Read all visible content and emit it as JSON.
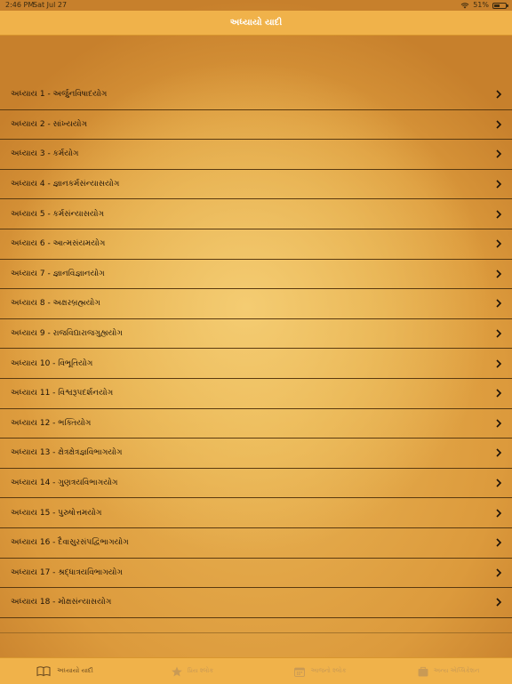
{
  "status_bar": {
    "time": "2:46 PM",
    "date": "Sat Jul 27",
    "battery_text": "51%",
    "battery_level": 0.51
  },
  "nav": {
    "title": "અધ્યાયો યાદી"
  },
  "chapters": [
    "અધ્યાય 1 - અર્જુનવિષાદયોગ",
    "અધ્યાય 2 - સાંખ્યયોગ",
    "અધ્યાય 3 - કર્મયોગ",
    "અધ્યાય 4 - જ્ઞાનકર્મસંન્યાસયોગ",
    "અધ્યાય 5 - કર્મસંન્યાસયોગ",
    "અધ્યાય 6 - આત્મસંયમયોગ",
    "અધ્યાય 7 - જ્ઞાનવિજ્ઞાનયોગ",
    "અધ્યાય 8 - અક્ષરબ્રહ્મયોગ",
    "અધ્યાય 9 - રાજવિદ્યારાજગુહ્યયોગ",
    "અધ્યાય 10 - વિભૂતિયોગ",
    "અધ્યાય 11 - વિશ્વરૂપદર્શનયોગ",
    "અધ્યાય 12 - ભક્તિયોગ",
    "અધ્યાય 13 - ક્ષેત્રક્ષેત્રજ્ઞવિભાગયોગ",
    "અધ્યાય 14 - ગુણત્રયવિભાગયોગ",
    "અધ્યાય 15 - પુરુષોત્તમયોગ",
    "અધ્યાય 16 - દૈવાસુરસંપદ્વિભાગયોગ",
    "અધ્યાય 17 - શ્રદ્ધાત્રયવિભાગયોગ",
    "અધ્યાય 18 - મોક્ષસંન્યાસયોગ"
  ],
  "tabs": [
    {
      "label": "અધ્યાયો યાદી",
      "icon": "book-icon",
      "active": true
    },
    {
      "label": "પ્રિય શ્લોક",
      "icon": "star-icon",
      "active": false
    },
    {
      "label": "આજનો શ્લોક",
      "icon": "calendar-icon",
      "active": false
    },
    {
      "label": "અન્ય એપ્લિકેશન",
      "icon": "apps-icon",
      "active": false
    }
  ],
  "colors": {
    "nav_bar": "#f0b24a",
    "tab_active": "#6a4a20",
    "tab_inactive": "#c99a55",
    "separator": "#5a3a10"
  }
}
